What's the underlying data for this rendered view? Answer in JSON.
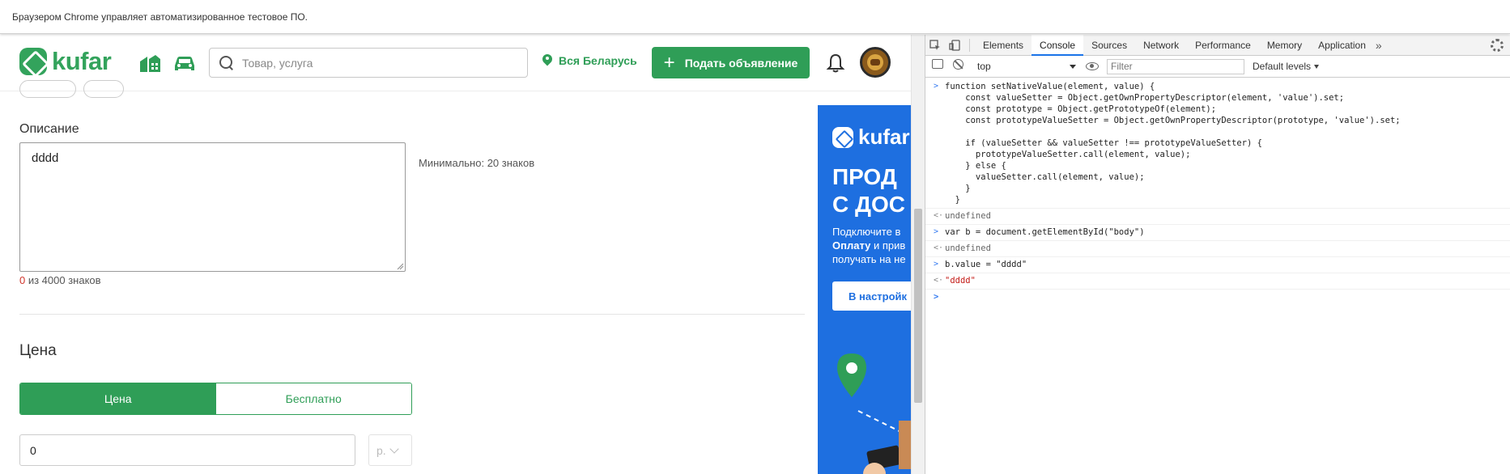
{
  "infobar": {
    "text": "Браузером Chrome управляет автоматизированное тестовое ПО."
  },
  "header": {
    "logo_text": "kufar",
    "search_placeholder": "Товар, услуга",
    "region": "Вся Беларусь",
    "post_button": "Подать объявление"
  },
  "form": {
    "description_label": "Описание",
    "description_value": "dddd",
    "min_hint": "Минимально: 20 знаков",
    "counter_current": "0",
    "counter_rest": " из 4000 знаков",
    "price_label": "Цена",
    "price_toggle": [
      "Цена",
      "Бесплатно"
    ],
    "price_value": "0",
    "currency": "р."
  },
  "ad": {
    "logo_text": "kufar",
    "headline_1": "ПРОД",
    "headline_2": "С ДОС",
    "body_1": "Подключите в",
    "body_2_bold": "Оплату",
    "body_2_rest": " и прив",
    "body_3": "получать на не",
    "button": "В настройк"
  },
  "devtools": {
    "tabs": [
      "Elements",
      "Console",
      "Sources",
      "Network",
      "Performance",
      "Memory",
      "Application"
    ],
    "active_tab": "Console",
    "more": "»",
    "context": "top",
    "filter_placeholder": "Filter",
    "levels": "Default levels",
    "prefix_in": ">",
    "prefix_out": "<·",
    "entries": {
      "fn_lines": [
        "function setNativeValue(element, value) {",
        "    const valueSetter = Object.getOwnPropertyDescriptor(element, 'value').set;",
        "    const prototype = Object.getPrototypeOf(element);",
        "    const prototypeValueSetter = Object.getOwnPropertyDescriptor(prototype, 'value').set;",
        "",
        "    if (valueSetter && valueSetter !== prototypeValueSetter) {",
        "      prototypeValueSetter.call(element, value);",
        "    } else {",
        "      valueSetter.call(element, value);",
        "    }",
        "  }"
      ],
      "out_1": "undefined",
      "cmd_2": "var b = document.getElementById(\"body\")",
      "out_2": "undefined",
      "cmd_3": "b.value = \"dddd\"",
      "out_3": "\"dddd\""
    }
  }
}
